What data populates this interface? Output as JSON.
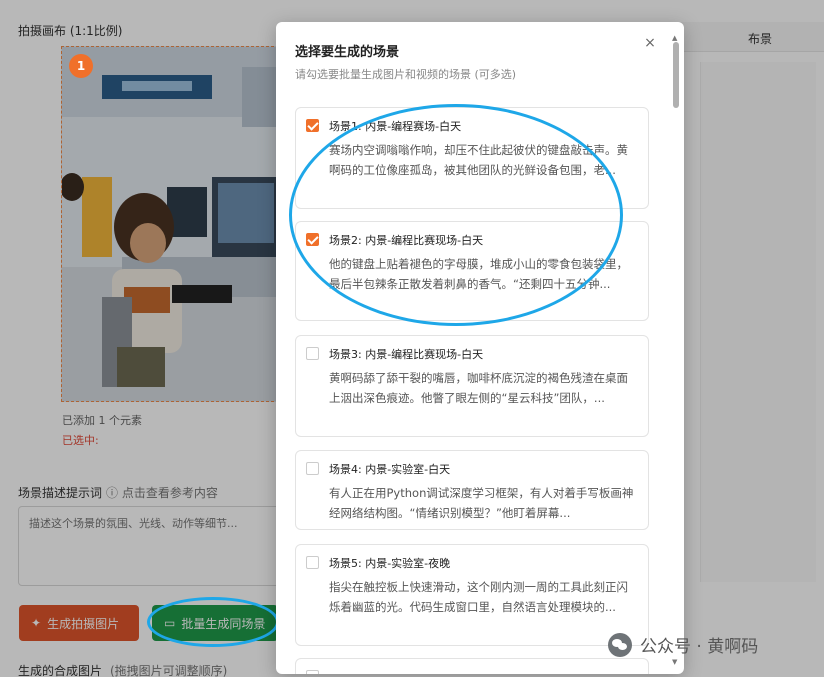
{
  "background": {
    "canvas_label": "拍摄画布 (1:1比例)",
    "top_right_label": "布景",
    "image_badge": "1",
    "added_text": "已添加 1 个元素",
    "selected_text": "已选中:",
    "scene_desc_label": "场景描述提示词",
    "scene_desc_hint": "ⓘ 点击查看参考内容",
    "desc_placeholder": "描述这个场景的氛围、光线、动作等细节...",
    "generate_button": "生成拍摄图片",
    "batch_button": "批量生成同场景",
    "bottom_label": "生成的合成图片",
    "bottom_hint": "(拖拽图片可调整顺序)"
  },
  "modal": {
    "title": "选择要生成的场景",
    "subtitle": "请勾选要批量生成图片和视频的场景 (可多选)",
    "close": "×",
    "scenes": [
      {
        "title": "场景1: 内景-编程赛场-白天",
        "desc": "赛场内空调嗡嗡作响，却压不住此起彼伏的键盘敲击声。黄啊码的工位像座孤岛，被其他团队的光鲜设备包围，老...",
        "checked": true
      },
      {
        "title": "场景2: 内景-编程比赛现场-白天",
        "desc": "他的键盘上贴着褪色的字母膜，堆成小山的零食包装袋里，最后半包辣条正散发着刺鼻的香气。“还剩四十五分钟...",
        "checked": true
      },
      {
        "title": "场景3: 内景-编程比赛现场-白天",
        "desc": "黄啊码舔了舔干裂的嘴唇，咖啡杯底沉淀的褐色残渣在桌面上洇出深色痕迹。他瞥了眼左侧的“星云科技”团队，...",
        "checked": false
      },
      {
        "title": "场景4: 内景-实验室-白天",
        "desc": "有人正在用Python调试深度学习框架，有人对着手写板画神经网络结构图。“情绪识别模型？”他盯着屏幕...",
        "checked": false
      },
      {
        "title": "场景5: 内景-实验室-夜晚",
        "desc": "指尖在触控板上快速滑动，这个刚内测一周的工具此刻正闪烁着幽蓝的光。代码生成窗口里，自然语言处理模块的...",
        "checked": false
      }
    ]
  },
  "watermark": "公众号 · 黄啊码",
  "colors": {
    "accent_orange": "#f0702a",
    "annotation_blue": "#1ea7e8",
    "batch_green": "#1f9a4a"
  }
}
